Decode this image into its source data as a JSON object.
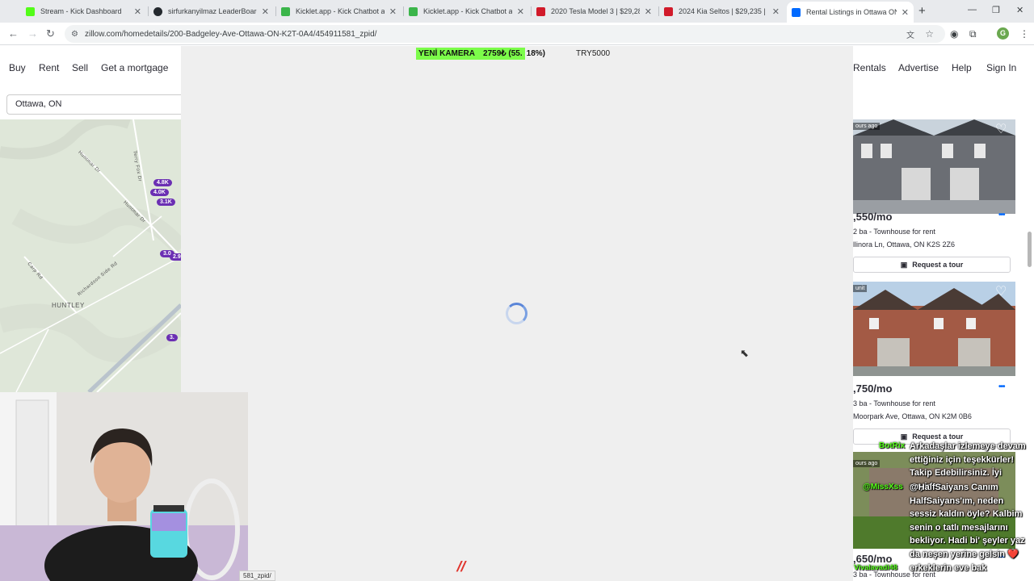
{
  "browser": {
    "tabs": [
      {
        "title": "Stream - Kick Dashboard",
        "favicon_color": "#53fc18"
      },
      {
        "title": "sirfurkanyilmaz LeaderBoard | T",
        "favicon_color": "#24292e"
      },
      {
        "title": "Kicklet.app - Kick Chatbot and",
        "favicon_color": "#3bb54a"
      },
      {
        "title": "Kicklet.app - Kick Chatbot and",
        "favicon_color": "#3bb54a"
      },
      {
        "title": "2020 Tesla Model 3 | $29,288 |",
        "favicon_color": "#d11a2a"
      },
      {
        "title": "2024 Kia Seltos | $29,235 | 58,0",
        "favicon_color": "#d11a2a"
      },
      {
        "title": "Rental Listings in Ottawa ON -",
        "favicon_color": "#006aff"
      }
    ],
    "url": "zillow.com/homedetails/200-Badgeley-Ave-Ottawa-ON-K2T-0A4/454911581_zpid/",
    "profile_initial": "G"
  },
  "zillow": {
    "nav_left": [
      "Buy",
      "Rent",
      "Sell",
      "Get a mortgage"
    ],
    "nav_right": [
      "Rentals",
      "Advertise",
      "Help",
      "Sign In"
    ],
    "search_value": "Ottawa, ON",
    "map": {
      "pins": [
        "4.8K",
        "4.0K",
        "3.1K",
        "3.0",
        "2.9",
        "3."
      ],
      "labels": [
        "HUNTLEY",
        "Huntmar Dr",
        "Terry Fox Dr",
        "Richardson Side Rd",
        "Carp Rd",
        "Huntmar Dr"
      ]
    },
    "listings": [
      {
        "price": ",550/mo",
        "beds": "2 ba",
        "type": "Townhouse for rent",
        "address": "llinora Ln, Ottawa, ON K2S 2Z6",
        "tour_label": "Request a tour",
        "badge": "ours ago"
      },
      {
        "price": ",750/mo",
        "beds": "3 ba",
        "type": "Townhouse for rent",
        "address": "Moorpark Ave, Ottawa, ON K2M 0B6",
        "tour_label": "Request a tour",
        "badge": "unit"
      },
      {
        "price": ",650/mo",
        "beds": "3 ba",
        "type": "Townhouse for rent",
        "address": "",
        "tour_label": "",
        "badge": "ours ago"
      }
    ]
  },
  "overlay": {
    "ticker_label": "YENİ KAMERA",
    "ticker_amount": "2759₺",
    "ticker_percent_green": "(55.",
    "ticker_percent_rest": "18%)",
    "ticker_progress": 0.5518,
    "ticker_goal": "TRY5000",
    "status_url": "581_zpid/"
  },
  "chat": [
    {
      "user": "BotRix",
      "user_color": "#53fc18",
      "text": "Arkadaşlar izlemeye devam ettiğiniz için teşekkürler! Takip Edebilirsiniz. İyi seyirler"
    },
    {
      "user": "@MissXss",
      "user_color": "#53fc18",
      "text": "@HalfSaiyans Canım HalfSaiyans'ım, neden sessiz kaldın öyle? Kalbim senin o tatlı mesajlarını bekliyor. Hadi bi' şeyler yaz da neşen yerine gelsin ❤️"
    },
    {
      "user": "Vivalavadi48",
      "user_color": "#53fc18",
      "text": "erkeklerin eve bak"
    }
  ]
}
